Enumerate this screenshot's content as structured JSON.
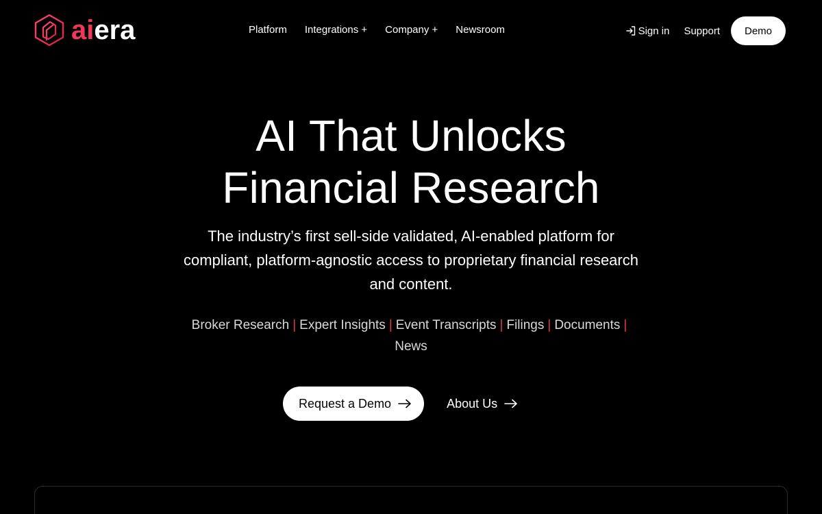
{
  "brand": {
    "logo_ai": "ai",
    "logo_era": "era",
    "accent_color": "#f0375a"
  },
  "nav": {
    "links": [
      {
        "label": "Platform"
      },
      {
        "label": "Integrations +"
      },
      {
        "label": "Company +"
      },
      {
        "label": "Newsroom"
      }
    ],
    "sign_in": "Sign in",
    "support": "Support",
    "demo": "Demo"
  },
  "hero": {
    "title_line1": "AI That Unlocks",
    "title_line2": "Financial Research",
    "subtitle": "The industry’s first sell-side validated, AI-enabled platform for compliant, platform-agnostic access to proprietary financial research and content.",
    "tags": [
      "Broker Research",
      "Expert Insights",
      "Event Transcripts",
      "Filings",
      "Documents",
      "News"
    ],
    "separator": "|",
    "cta_primary": "Request a Demo",
    "cta_secondary": "About Us"
  },
  "icons": {
    "sign_in": "sign-in-icon",
    "arrow": "arrow-right-icon",
    "logo": "aiera-logo-mark"
  }
}
